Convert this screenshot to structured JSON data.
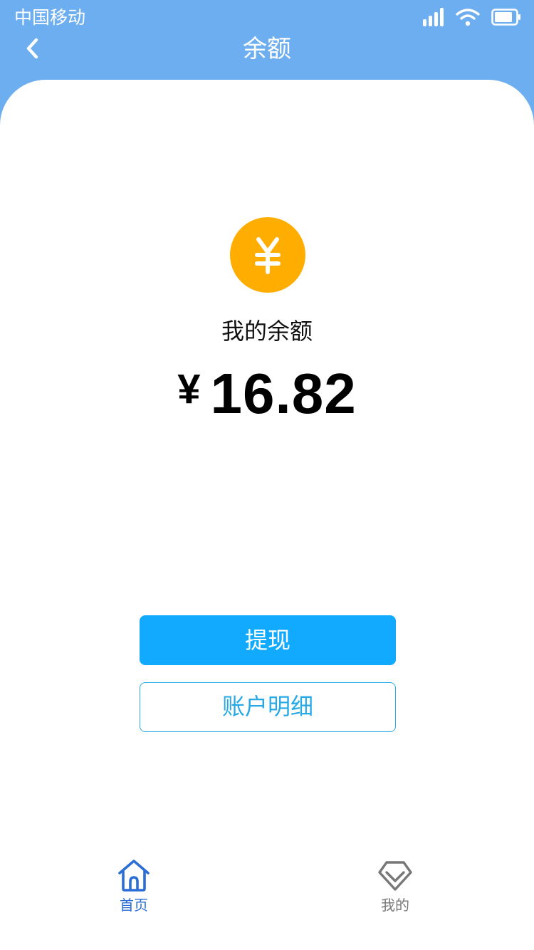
{
  "status_bar": {
    "carrier": "中国移动",
    "icons": [
      "signal-icon",
      "wifi-icon",
      "battery-icon"
    ]
  },
  "nav": {
    "title": "余额",
    "back_icon": "chevron-left-icon"
  },
  "balance": {
    "icon": "yuan-coin-icon",
    "label": "我的余额",
    "currency_symbol": "¥",
    "amount": "16.82"
  },
  "actions": {
    "withdraw_label": "提现",
    "details_label": "账户明细"
  },
  "tab_bar": {
    "items": [
      {
        "label": "首页",
        "icon": "home-icon",
        "active": true
      },
      {
        "label": "我的",
        "icon": "diamond-icon",
        "active": false
      }
    ]
  },
  "colors": {
    "header_bg": "#6daef0",
    "coin": "#ffad00",
    "primary_button": "#12aaff",
    "outline_button": "#27a9e6",
    "tab_active": "#2a6ed6",
    "tab_inactive": "#777777"
  }
}
